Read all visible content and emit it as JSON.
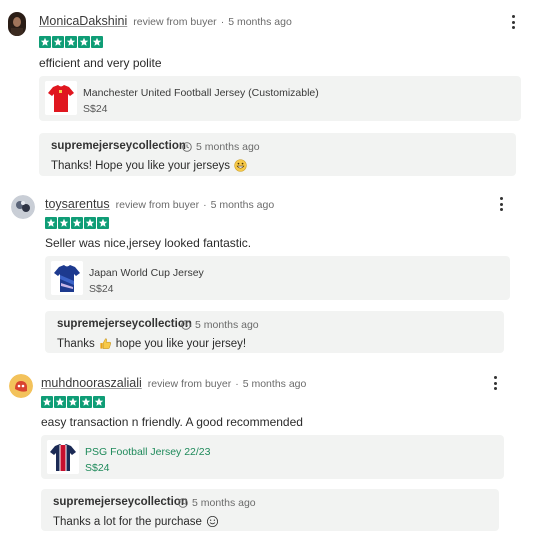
{
  "reviews": [
    {
      "username": "MonicaDakshini",
      "meta": "review from buyer",
      "time": "5 months ago",
      "rating": 5,
      "comment": "efficient and very polite",
      "product": {
        "name": "Manchester United Football Jersey (Customizable)",
        "price": "S$24"
      },
      "reply": {
        "seller": "supremejerseycollection",
        "time": "5 months ago",
        "text": "Thanks! Hope you like your jerseys",
        "emoji": "grinning-face-emoji"
      }
    },
    {
      "username": "toysarentus",
      "meta": "review from buyer",
      "time": "5 months ago",
      "rating": 5,
      "comment": "Seller was nice,jersey looked fantastic.",
      "product": {
        "name": "Japan World Cup Jersey",
        "price": "S$24"
      },
      "reply": {
        "seller": "supremejerseycollection",
        "time": "5 months ago",
        "text_before": "Thanks",
        "text_after": "hope you like your jersey!",
        "emoji": "thumbs-up-emoji"
      }
    },
    {
      "username": "muhdnooraszaliali",
      "meta": "review from buyer",
      "time": "5 months ago",
      "rating": 5,
      "comment": "easy transaction n friendly. A good recommended",
      "product": {
        "name": "PSG Football Jersey 22/23",
        "price": "S$24"
      },
      "reply": {
        "seller": "supremejerseycollection",
        "time": "5 months ago",
        "text": "Thanks a lot for the purchase",
        "emoji": "smiling-face-emoji"
      }
    }
  ],
  "colors": {
    "star": "#0f9d76",
    "card": "#f2f3f2",
    "product_link_green": "#1f8a5b"
  }
}
